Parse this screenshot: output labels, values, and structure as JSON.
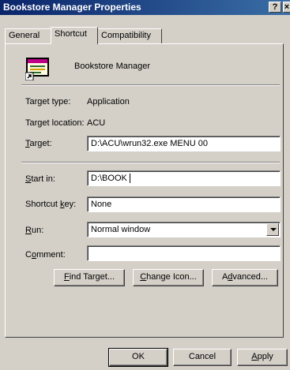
{
  "window": {
    "title": "Bookstore Manager Properties",
    "help_button": "?",
    "close_button": "×"
  },
  "tabs": [
    {
      "label": "General",
      "active": false
    },
    {
      "label": "Shortcut",
      "active": true
    },
    {
      "label": "Compatibility",
      "active": false
    }
  ],
  "header": {
    "app_name": "Bookstore Manager",
    "icon": "application-shortcut-icon"
  },
  "fields": {
    "target_type_label": "Target type:",
    "target_type_value": "Application",
    "target_location_label": "Target location:",
    "target_location_value": "ACU",
    "target_label": "Target:",
    "target_value": "D:\\ACU\\wrun32.exe MENU 00",
    "start_in_label": "Start in:",
    "start_in_value": "D:\\BOOK",
    "shortcut_key_label": "Shortcut key:",
    "shortcut_key_value": "None",
    "run_label": "Run:",
    "run_value": "Normal window",
    "comment_label": "Comment:",
    "comment_value": ""
  },
  "buttons": {
    "find_target": "Find Target...",
    "change_icon": "Change Icon...",
    "advanced": "Advanced...",
    "ok": "OK",
    "cancel": "Cancel",
    "apply": "Apply"
  },
  "colors": {
    "title_bar": "#0a246a",
    "dialog_face": "#d4d0c8"
  }
}
